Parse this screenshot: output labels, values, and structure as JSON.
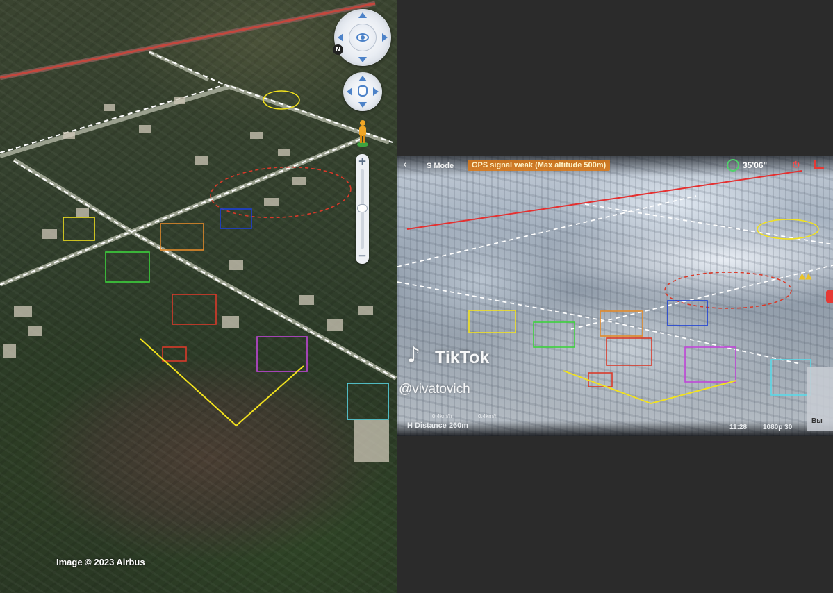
{
  "satellite_view": {
    "attribution": "Image © 2023 Airbus",
    "controls": {
      "north_label": "N",
      "zoom_in_label": "+",
      "zoom_out_label": "−",
      "look_control": "eye-icon",
      "move_control": "hand-icon",
      "pegman": "street-view-pegman-icon"
    }
  },
  "drone_view": {
    "back_glyph": "‹",
    "mode": "S Mode",
    "warning": "GPS signal weak (Max altitude 500m)",
    "battery": "35'06\"",
    "record_glyph": "⏻",
    "speed_a": "0.4km/h",
    "speed_b": "0.4km/h",
    "height_label": "H",
    "distance_label": "Distance",
    "distance_value": "260m",
    "time": "11:28",
    "resolution": "1080p 30",
    "side_label": "Вы",
    "warning_glyph": "▲▲",
    "watermark": {
      "logo_glyph": "♪",
      "brand": "TikTok",
      "handle": "@vivatovich"
    }
  },
  "colors": {
    "yellow": "#f2e21e",
    "orange": "#e38a2a",
    "blue": "#1c3fd6",
    "green": "#3dd23d",
    "red": "#d93a2a",
    "magenta": "#c046d8",
    "cyan": "#5ad9e8",
    "redline": "#e53030",
    "dashes": "#ffffff"
  }
}
